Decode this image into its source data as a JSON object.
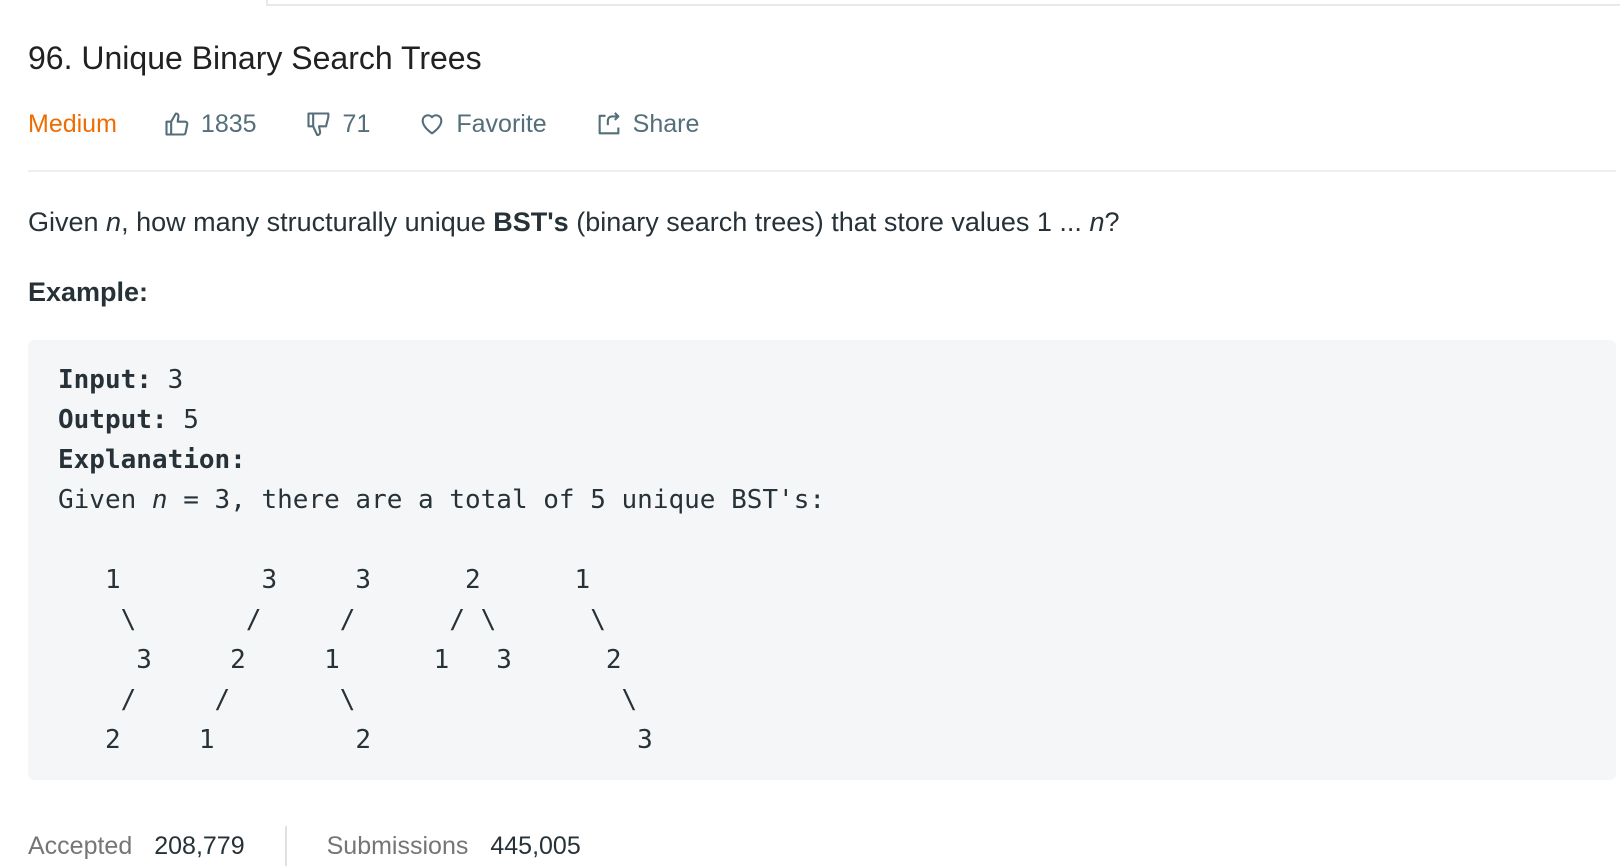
{
  "problem": {
    "title": "96. Unique Binary Search Trees",
    "difficulty": "Medium",
    "likes": "1835",
    "dislikes": "71",
    "favorite_label": "Favorite",
    "share_label": "Share"
  },
  "description": {
    "given": "Given ",
    "n": "n",
    "mid": ", how many structurally unique ",
    "bst": "BST's",
    "rest": " (binary search trees) that store values 1 ... ",
    "n2": "n",
    "end": "?"
  },
  "example": {
    "heading": "Example:",
    "input_label": "Input:",
    "input_value": " 3",
    "output_label": "Output:",
    "output_value": " 5",
    "explanation_label": "Explanation:",
    "given_prefix": "Given ",
    "given_n": "n",
    "given_rest": " = 3, there are a total of 5 unique BST's:",
    "tree_rows": [
      "   1         3     3      2      1",
      "    \\       /     /      / \\      \\",
      "     3     2     1      1   3      2",
      "    /     /       \\                 \\",
      "   2     1         2                 3"
    ]
  },
  "stats": {
    "accepted_label": "Accepted",
    "accepted_value": "208,779",
    "submissions_label": "Submissions",
    "submissions_value": "445,005"
  },
  "colors": {
    "difficulty": "#ef6c00",
    "meta": "#546e7a",
    "code_bg": "#f5f6f8"
  },
  "icons": {
    "like": "thumbs-up-icon",
    "dislike": "thumbs-down-icon",
    "favorite": "heart-icon",
    "share": "share-icon"
  }
}
